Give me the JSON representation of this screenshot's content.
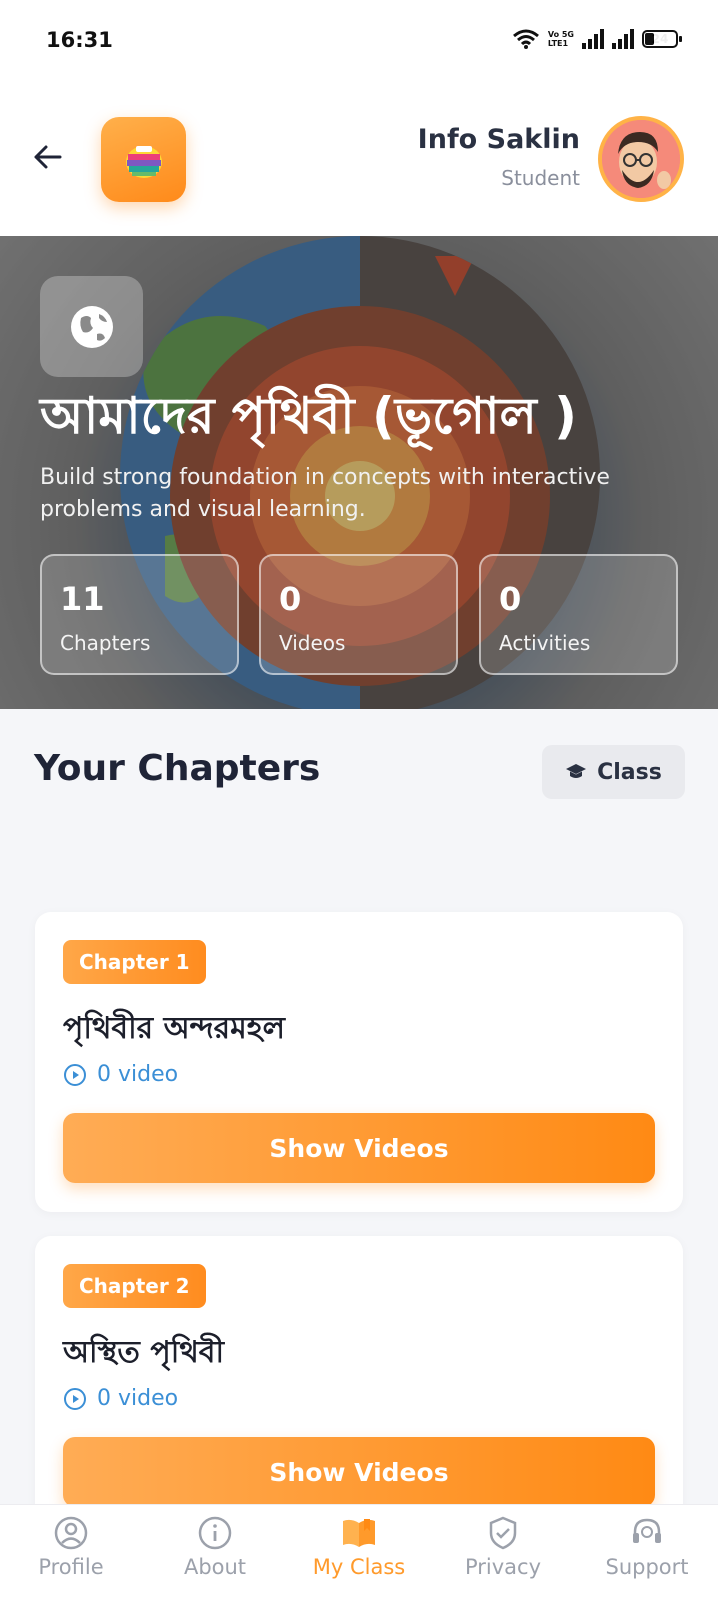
{
  "status_bar": {
    "time": "16:31",
    "volte_top": "Vo 5G",
    "volte_bottom": "LTE1",
    "battery_level": "24"
  },
  "header": {
    "user_name": "Info Saklin",
    "user_role": "Student"
  },
  "hero": {
    "title": "আমাদের পৃথিবী (ভূগোল  )",
    "description": "Build strong foundation in concepts with interactive problems and visual learning.",
    "stats": [
      {
        "value": "11",
        "label": "Chapters"
      },
      {
        "value": "0",
        "label": "Videos"
      },
      {
        "value": "0",
        "label": "Activities"
      }
    ]
  },
  "chapters_section": {
    "title": "Your Chapters",
    "class_button": "Class",
    "chapters": [
      {
        "badge": "Chapter 1",
        "title": "পৃথিবীর অন্দরমহল",
        "video_count": "0 video",
        "button": "Show Videos"
      },
      {
        "badge": "Chapter 2",
        "title": "অস্থিত পৃথিবী",
        "video_count": "0 video",
        "button": "Show Videos"
      }
    ]
  },
  "bottom_nav": {
    "items": [
      {
        "label": "Profile",
        "icon": "profile-icon"
      },
      {
        "label": "About",
        "icon": "info-icon"
      },
      {
        "label": "My Class",
        "icon": "book-icon",
        "active": true
      },
      {
        "label": "Privacy",
        "icon": "shield-icon"
      },
      {
        "label": "Support",
        "icon": "headset-icon"
      }
    ]
  },
  "colors": {
    "accent": "#ff9a2b",
    "link": "#3b8fd6",
    "title": "#1f2437"
  }
}
